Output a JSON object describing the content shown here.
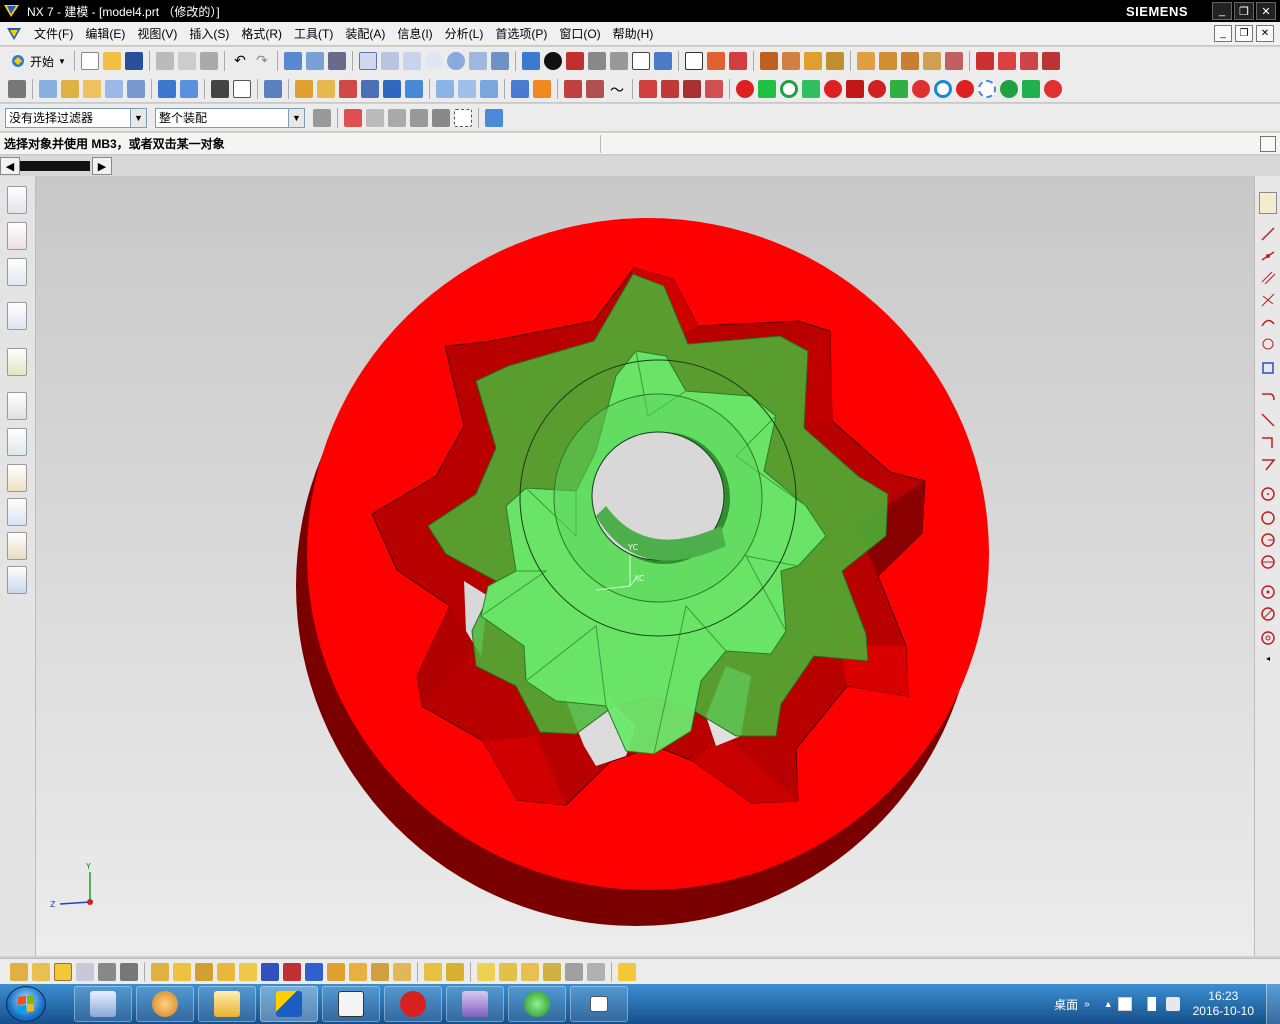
{
  "window": {
    "title": "NX 7 - 建模 - [model4.prt （修改的）]",
    "brand": "SIEMENS"
  },
  "menu": {
    "items": [
      "文件(F)",
      "编辑(E)",
      "视图(V)",
      "插入(S)",
      "格式(R)",
      "工具(T)",
      "装配(A)",
      "信息(I)",
      "分析(L)",
      "首选项(P)",
      "窗口(O)",
      "帮助(H)"
    ]
  },
  "toolbar": {
    "start_label": "开始"
  },
  "selection": {
    "filter_value": "没有选择过滤器",
    "scope_value": "整个装配"
  },
  "cue_line": {
    "text": "选择对象并使用 MB3，或者双击某一对象"
  },
  "viewport": {
    "wcs_y_label": "YC",
    "wcs_x_label": "XC",
    "triad_y": "Y",
    "triad_z": "Z",
    "colors": {
      "housing": "#ff0000",
      "housing_side": "#7a0000",
      "gear": "#55e055"
    }
  },
  "taskbar": {
    "tray_label": "桌面",
    "time": "16:23",
    "date": "2016-10-10"
  }
}
